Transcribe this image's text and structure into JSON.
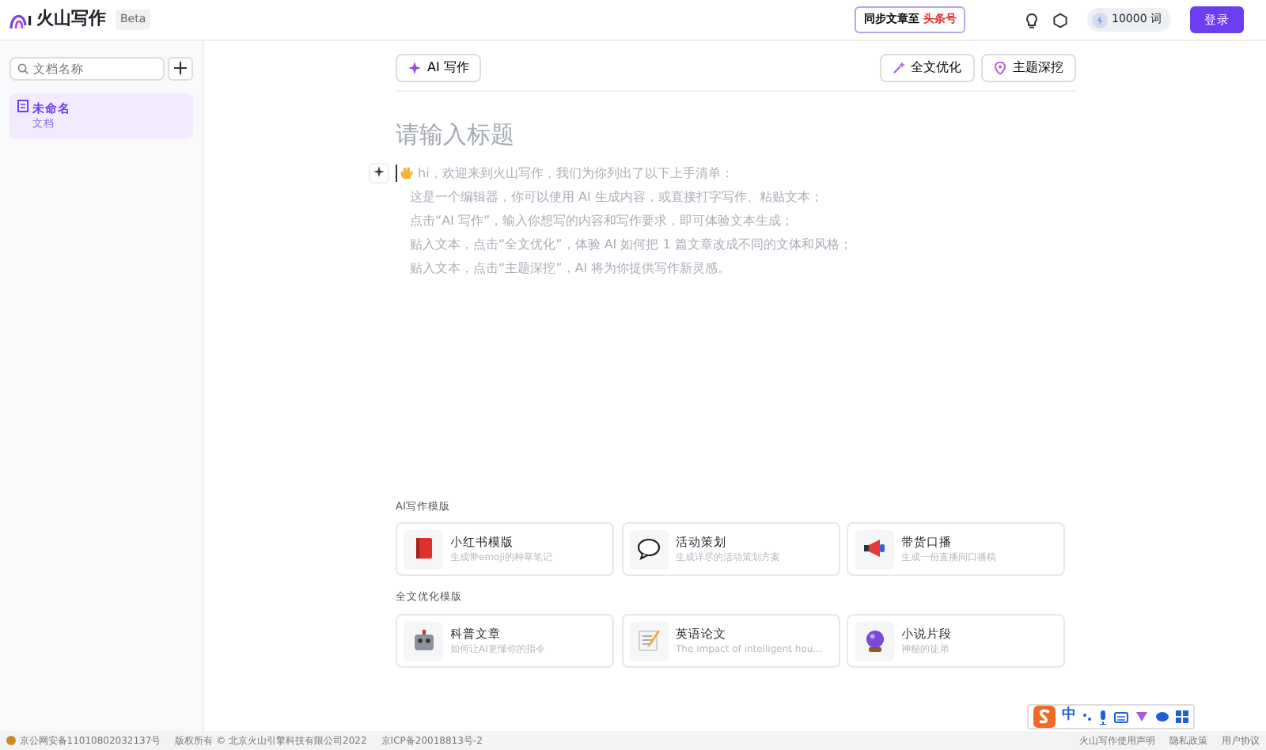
{
  "header": {
    "logo_text": "火山写作",
    "badge": "Beta",
    "sync_button": {
      "text": "同步文章至",
      "highlight": "头条号"
    },
    "credits": "10000 词",
    "login": "登录"
  },
  "sidebar": {
    "search": {
      "placeholder": "文档名称"
    },
    "documents": [
      {
        "title": "未命名",
        "subtitle": "文档",
        "selected": true
      }
    ]
  },
  "toolbar": {
    "left": [
      {
        "label": "AI 写作",
        "kind": "sparkle"
      }
    ],
    "right": [
      {
        "label": "全文优化",
        "kind": "wand"
      },
      {
        "label": "主题深挖",
        "kind": "pin"
      }
    ]
  },
  "editor": {
    "title_placeholder": "请输入标题",
    "intro": [
      "hi，欢迎来到火山写作，我们为你列出了以下上手清单：",
      "这是一个编辑器，你可以使用 AI 生成内容，或直接打字写作、粘贴文本；",
      "点击“AI 写作”，输入你想写的内容和写作要求，即可体验文本生成；",
      "贴入文本，点击“全文优化”，体验 AI 如何把 1 篇文章改成不同的文体和风格；",
      "贴入文本，点击“主题深挖”，AI 将为你提供写作新灵感。"
    ]
  },
  "template_sections": [
    {
      "heading": "AI写作模版",
      "templates": [
        {
          "title": "小红书模版",
          "description": "生成带emoji的种草笔记",
          "kind": "book"
        },
        {
          "title": "活动策划",
          "description": "生成详尽的活动策划方案",
          "kind": "speech"
        },
        {
          "title": "带货口播",
          "description": "生成一份直播间口播稿",
          "kind": "megaphone"
        }
      ]
    },
    {
      "heading": "全文优化模版",
      "templates": [
        {
          "title": "科普文章",
          "description": "如何让AI更懂你的指令",
          "kind": "robot"
        },
        {
          "title": "英语论文",
          "description": "The impact of intelligent hou…",
          "kind": "memo"
        },
        {
          "title": "小说片段",
          "description": "神秘的徒弟",
          "kind": "ball"
        }
      ]
    }
  ],
  "footer": {
    "left": [
      "京公网安备11010802032137号",
      "版权所有 © 北京火山引擎科技有限公司2022",
      "京ICP备20018813号-2"
    ],
    "right": [
      "火山写作使用声明",
      "隐私政策",
      "用户协议"
    ]
  },
  "ime_toolbar": {
    "mode": "中"
  }
}
